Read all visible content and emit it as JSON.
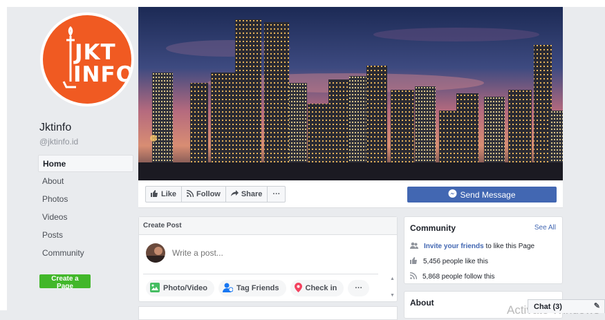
{
  "page": {
    "name": "Jktinfo",
    "handle": "@jktinfo.id",
    "logo_lines": [
      "JKT",
      "INFO"
    ]
  },
  "nav": {
    "items": [
      "Home",
      "About",
      "Photos",
      "Videos",
      "Posts",
      "Community"
    ],
    "active": "Home",
    "create_page": "Create a Page"
  },
  "actions": {
    "like": "Like",
    "follow": "Follow",
    "share": "Share",
    "more": "···",
    "send_message": "Send Message"
  },
  "create_post": {
    "title": "Create Post",
    "placeholder": "Write a post...",
    "buttons": [
      "Photo/Video",
      "Tag Friends",
      "Check in",
      "···"
    ]
  },
  "community": {
    "title": "Community",
    "see_all": "See All",
    "invite_link": "Invite your friends",
    "invite_rest": " to like this Page",
    "likes": "5,456 people like this",
    "follows": "5,868 people follow this"
  },
  "about": {
    "title": "About"
  },
  "overlay": {
    "activate": "Activate Windows"
  },
  "chat": {
    "label": "Chat (3)"
  },
  "colors": {
    "brand_blue": "#4267b2",
    "green": "#42b72a",
    "logo_orange": "#f05a22",
    "bg": "#e9ebee"
  }
}
